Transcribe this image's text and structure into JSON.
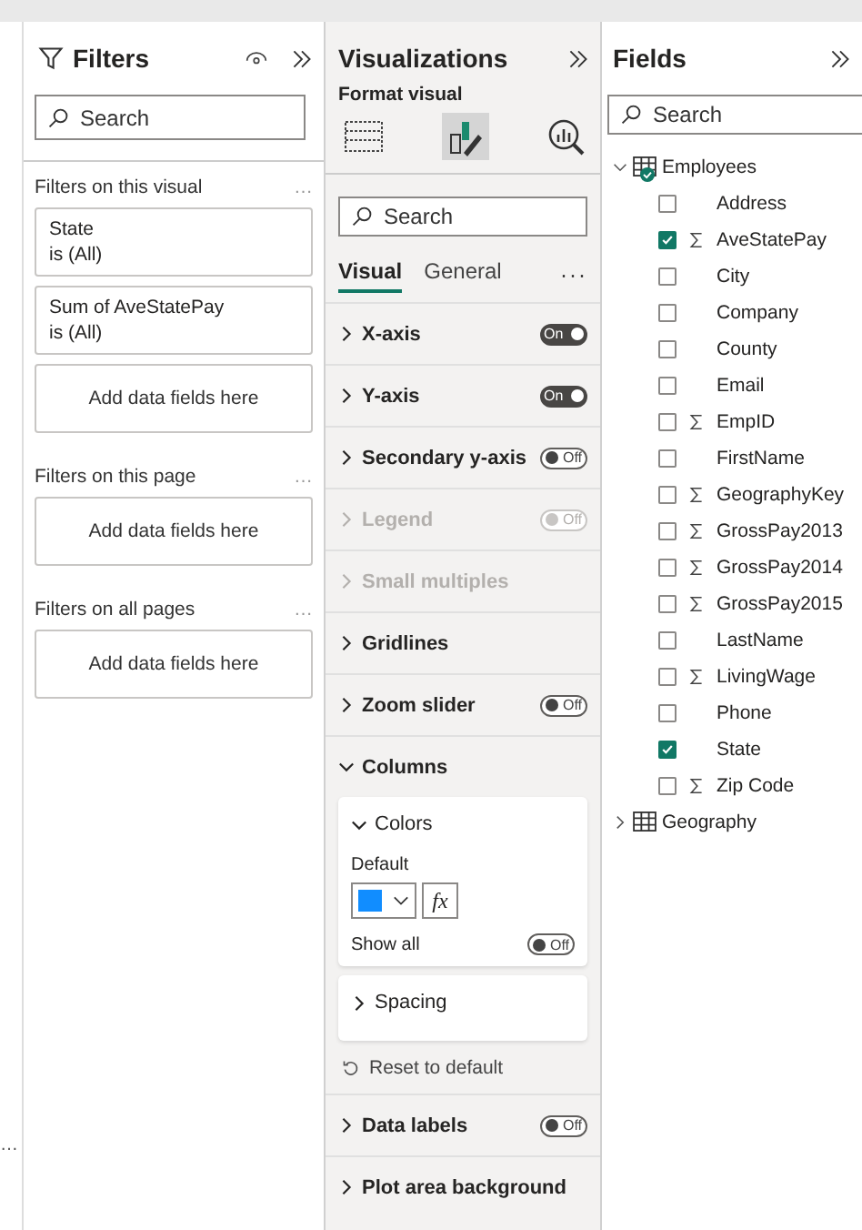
{
  "left_edge": {
    "more": "…"
  },
  "filters": {
    "title": "Filters",
    "search": {
      "placeholder": "Search"
    },
    "sections": [
      {
        "title": "Filters on this visual",
        "more": "…",
        "cards": [
          {
            "kind": "filter",
            "name": "State",
            "value": "is (All)"
          },
          {
            "kind": "filter",
            "name": "Sum of AveStatePay",
            "value": "is (All)"
          },
          {
            "kind": "drop",
            "text": "Add data fields here"
          }
        ]
      },
      {
        "title": "Filters on this page",
        "more": "…",
        "cards": [
          {
            "kind": "drop",
            "text": "Add data fields here"
          }
        ]
      },
      {
        "title": "Filters on all pages",
        "more": "…",
        "cards": [
          {
            "kind": "drop",
            "text": "Add data fields here"
          }
        ]
      }
    ]
  },
  "visualizations": {
    "title": "Visualizations",
    "subtitle": "Format visual",
    "build_tabs": [
      {
        "kind": "table",
        "selected": false
      },
      {
        "kind": "format",
        "selected": true
      },
      {
        "kind": "analytics",
        "selected": false
      }
    ],
    "search": {
      "placeholder": "Search"
    },
    "tabs": [
      {
        "label": "Visual",
        "selected": true
      },
      {
        "label": "General",
        "selected": false
      }
    ],
    "more": "···",
    "items": [
      {
        "kind": "section",
        "label": "X-axis",
        "expanded": false,
        "disabled": false,
        "toggle": {
          "on": true,
          "text": "On"
        }
      },
      {
        "kind": "section",
        "label": "Y-axis",
        "expanded": false,
        "disabled": false,
        "toggle": {
          "on": true,
          "text": "On"
        }
      },
      {
        "kind": "section",
        "label": "Secondary y-axis",
        "expanded": false,
        "disabled": false,
        "toggle": {
          "on": false,
          "text": "Off"
        }
      },
      {
        "kind": "section",
        "label": "Legend",
        "expanded": false,
        "disabled": true,
        "toggle": {
          "on": false,
          "text": "Off"
        }
      },
      {
        "kind": "section",
        "label": "Small multiples",
        "expanded": false,
        "disabled": true
      },
      {
        "kind": "section",
        "label": "Gridlines",
        "expanded": false,
        "disabled": false
      },
      {
        "kind": "section",
        "label": "Zoom slider",
        "expanded": false,
        "disabled": false,
        "toggle": {
          "on": false,
          "text": "Off"
        }
      },
      {
        "kind": "section",
        "label": "Columns",
        "expanded": true,
        "disabled": false,
        "cards": [
          {
            "label": "Colors",
            "expanded": true,
            "field_label": "Default",
            "color": "#118dff",
            "fx": "fx",
            "option": {
              "label": "Show all",
              "toggle": {
                "on": false,
                "text": "Off"
              }
            }
          },
          {
            "label": "Spacing",
            "expanded": false
          }
        ],
        "reset": "Reset to default"
      },
      {
        "kind": "section",
        "label": "Data labels",
        "expanded": false,
        "disabled": false,
        "toggle": {
          "on": false,
          "text": "Off"
        }
      },
      {
        "kind": "section",
        "label": "Plot area background",
        "expanded": false,
        "disabled": false
      }
    ]
  },
  "fields": {
    "title": "Fields",
    "search": {
      "placeholder": "Search"
    },
    "tables": [
      {
        "name": "Employees",
        "expanded": true,
        "in_use": true,
        "children": [
          {
            "name": "Address",
            "checked": false,
            "kind": "text"
          },
          {
            "name": "AveStatePay",
            "checked": true,
            "kind": "sum"
          },
          {
            "name": "City",
            "checked": false,
            "kind": "text"
          },
          {
            "name": "Company",
            "checked": false,
            "kind": "text"
          },
          {
            "name": "County",
            "checked": false,
            "kind": "text"
          },
          {
            "name": "Email",
            "checked": false,
            "kind": "text"
          },
          {
            "name": "EmpID",
            "checked": false,
            "kind": "sum"
          },
          {
            "name": "FirstName",
            "checked": false,
            "kind": "text"
          },
          {
            "name": "GeographyKey",
            "checked": false,
            "kind": "sum"
          },
          {
            "name": "GrossPay2013",
            "checked": false,
            "kind": "sum"
          },
          {
            "name": "GrossPay2014",
            "checked": false,
            "kind": "sum"
          },
          {
            "name": "GrossPay2015",
            "checked": false,
            "kind": "sum"
          },
          {
            "name": "LastName",
            "checked": false,
            "kind": "text"
          },
          {
            "name": "LivingWage",
            "checked": false,
            "kind": "sum"
          },
          {
            "name": "Phone",
            "checked": false,
            "kind": "text"
          },
          {
            "name": "State",
            "checked": true,
            "kind": "text"
          },
          {
            "name": "Zip Code",
            "checked": false,
            "kind": "sum"
          }
        ]
      },
      {
        "name": "Geography",
        "expanded": false,
        "in_use": false
      }
    ]
  }
}
